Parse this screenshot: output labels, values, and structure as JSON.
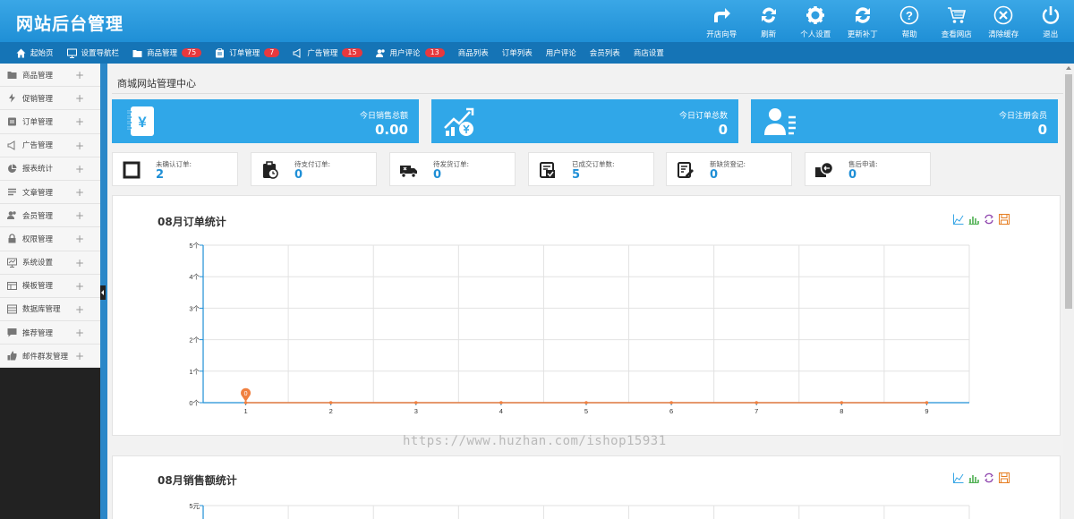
{
  "header": {
    "logo": "网站后台管理",
    "buttons": [
      {
        "label": "开店向导",
        "icon": "share-arrow-icon"
      },
      {
        "label": "刷新",
        "icon": "refresh-icon"
      },
      {
        "label": "个人设置",
        "icon": "gear-icon"
      },
      {
        "label": "更新补丁",
        "icon": "sync-icon"
      },
      {
        "label": "帮助",
        "icon": "help-icon"
      },
      {
        "label": "查看网店",
        "icon": "cart-icon"
      },
      {
        "label": "清除缓存",
        "icon": "close-circle-icon"
      },
      {
        "label": "退出",
        "icon": "power-icon"
      }
    ]
  },
  "nav": {
    "items": [
      {
        "label": "起始页",
        "icon": "home-icon",
        "badge": ""
      },
      {
        "label": "设置导航栏",
        "icon": "desktop-icon",
        "badge": ""
      },
      {
        "label": "商品管理",
        "icon": "folder-icon",
        "badge": "75"
      },
      {
        "label": "订单管理",
        "icon": "clipboard-icon",
        "badge": "7"
      },
      {
        "label": "广告管理",
        "icon": "megaphone-icon",
        "badge": "15"
      },
      {
        "label": "用户评论",
        "icon": "users-icon",
        "badge": "13"
      },
      {
        "label": "商品列表",
        "icon": "",
        "badge": ""
      },
      {
        "label": "订单列表",
        "icon": "",
        "badge": ""
      },
      {
        "label": "用户评论",
        "icon": "",
        "badge": ""
      },
      {
        "label": "会员列表",
        "icon": "",
        "badge": ""
      },
      {
        "label": "商店设置",
        "icon": "",
        "badge": ""
      }
    ]
  },
  "sidebar": {
    "items": [
      {
        "label": "商品管理",
        "icon": "folder-icon"
      },
      {
        "label": "促销管理",
        "icon": "bolt-icon"
      },
      {
        "label": "订单管理",
        "icon": "clipboard-icon"
      },
      {
        "label": "广告管理",
        "icon": "megaphone-icon"
      },
      {
        "label": "报表统计",
        "icon": "pie-chart-icon"
      },
      {
        "label": "文章管理",
        "icon": "list-icon"
      },
      {
        "label": "会员管理",
        "icon": "users-icon"
      },
      {
        "label": "权限管理",
        "icon": "lock-icon"
      },
      {
        "label": "系统设置",
        "icon": "desktop-icon"
      },
      {
        "label": "模板管理",
        "icon": "template-icon"
      },
      {
        "label": "数据库管理",
        "icon": "database-icon"
      },
      {
        "label": "推荐管理",
        "icon": "comment-icon"
      },
      {
        "label": "邮件群发管理",
        "icon": "thumbs-up-icon"
      }
    ],
    "plus": "+"
  },
  "main": {
    "title": "商城网站管理中心",
    "stats": [
      {
        "title": "今日销售总额",
        "value": "0.00",
        "icon": "money-notebook-icon"
      },
      {
        "title": "今日订单总数",
        "value": "0",
        "icon": "growth-chart-icon"
      },
      {
        "title": "今日注册会员",
        "value": "0",
        "icon": "member-card-icon"
      }
    ],
    "minis": [
      {
        "label": "未确认订单:",
        "value": "2",
        "icon": "square-icon"
      },
      {
        "label": "待支付订单:",
        "value": "0",
        "icon": "pending-payment-icon"
      },
      {
        "label": "待发货订单:",
        "value": "0",
        "icon": "delivery-truck-icon"
      },
      {
        "label": "已成交订单数:",
        "value": "5",
        "icon": "completed-order-icon"
      },
      {
        "label": "新缺货登记:",
        "value": "0",
        "icon": "edit-note-icon"
      },
      {
        "label": "售后申请:",
        "value": "0",
        "icon": "return-icon"
      }
    ],
    "watermark": "https://www.huzhan.com/ishop15931"
  },
  "chart_data": [
    {
      "type": "line",
      "title": "08月订单统计",
      "x": [
        1,
        2,
        3,
        4,
        5,
        6,
        7,
        8,
        9
      ],
      "y_tick_labels": [
        "0个",
        "1个",
        "2个",
        "3个",
        "4个",
        "5个"
      ],
      "ylim": [
        0,
        5
      ],
      "series": [
        {
          "values": [
            0,
            0,
            0,
            0,
            0,
            0,
            0,
            0,
            0
          ]
        }
      ],
      "annotations": [
        {
          "x": 1,
          "y": 0,
          "text": "0"
        }
      ],
      "grid": true,
      "color": "#f08040"
    },
    {
      "type": "line",
      "title": "08月销售额统计",
      "y_tick_labels": [
        "5元"
      ],
      "ylim": [
        0,
        5
      ],
      "grid": true
    }
  ]
}
